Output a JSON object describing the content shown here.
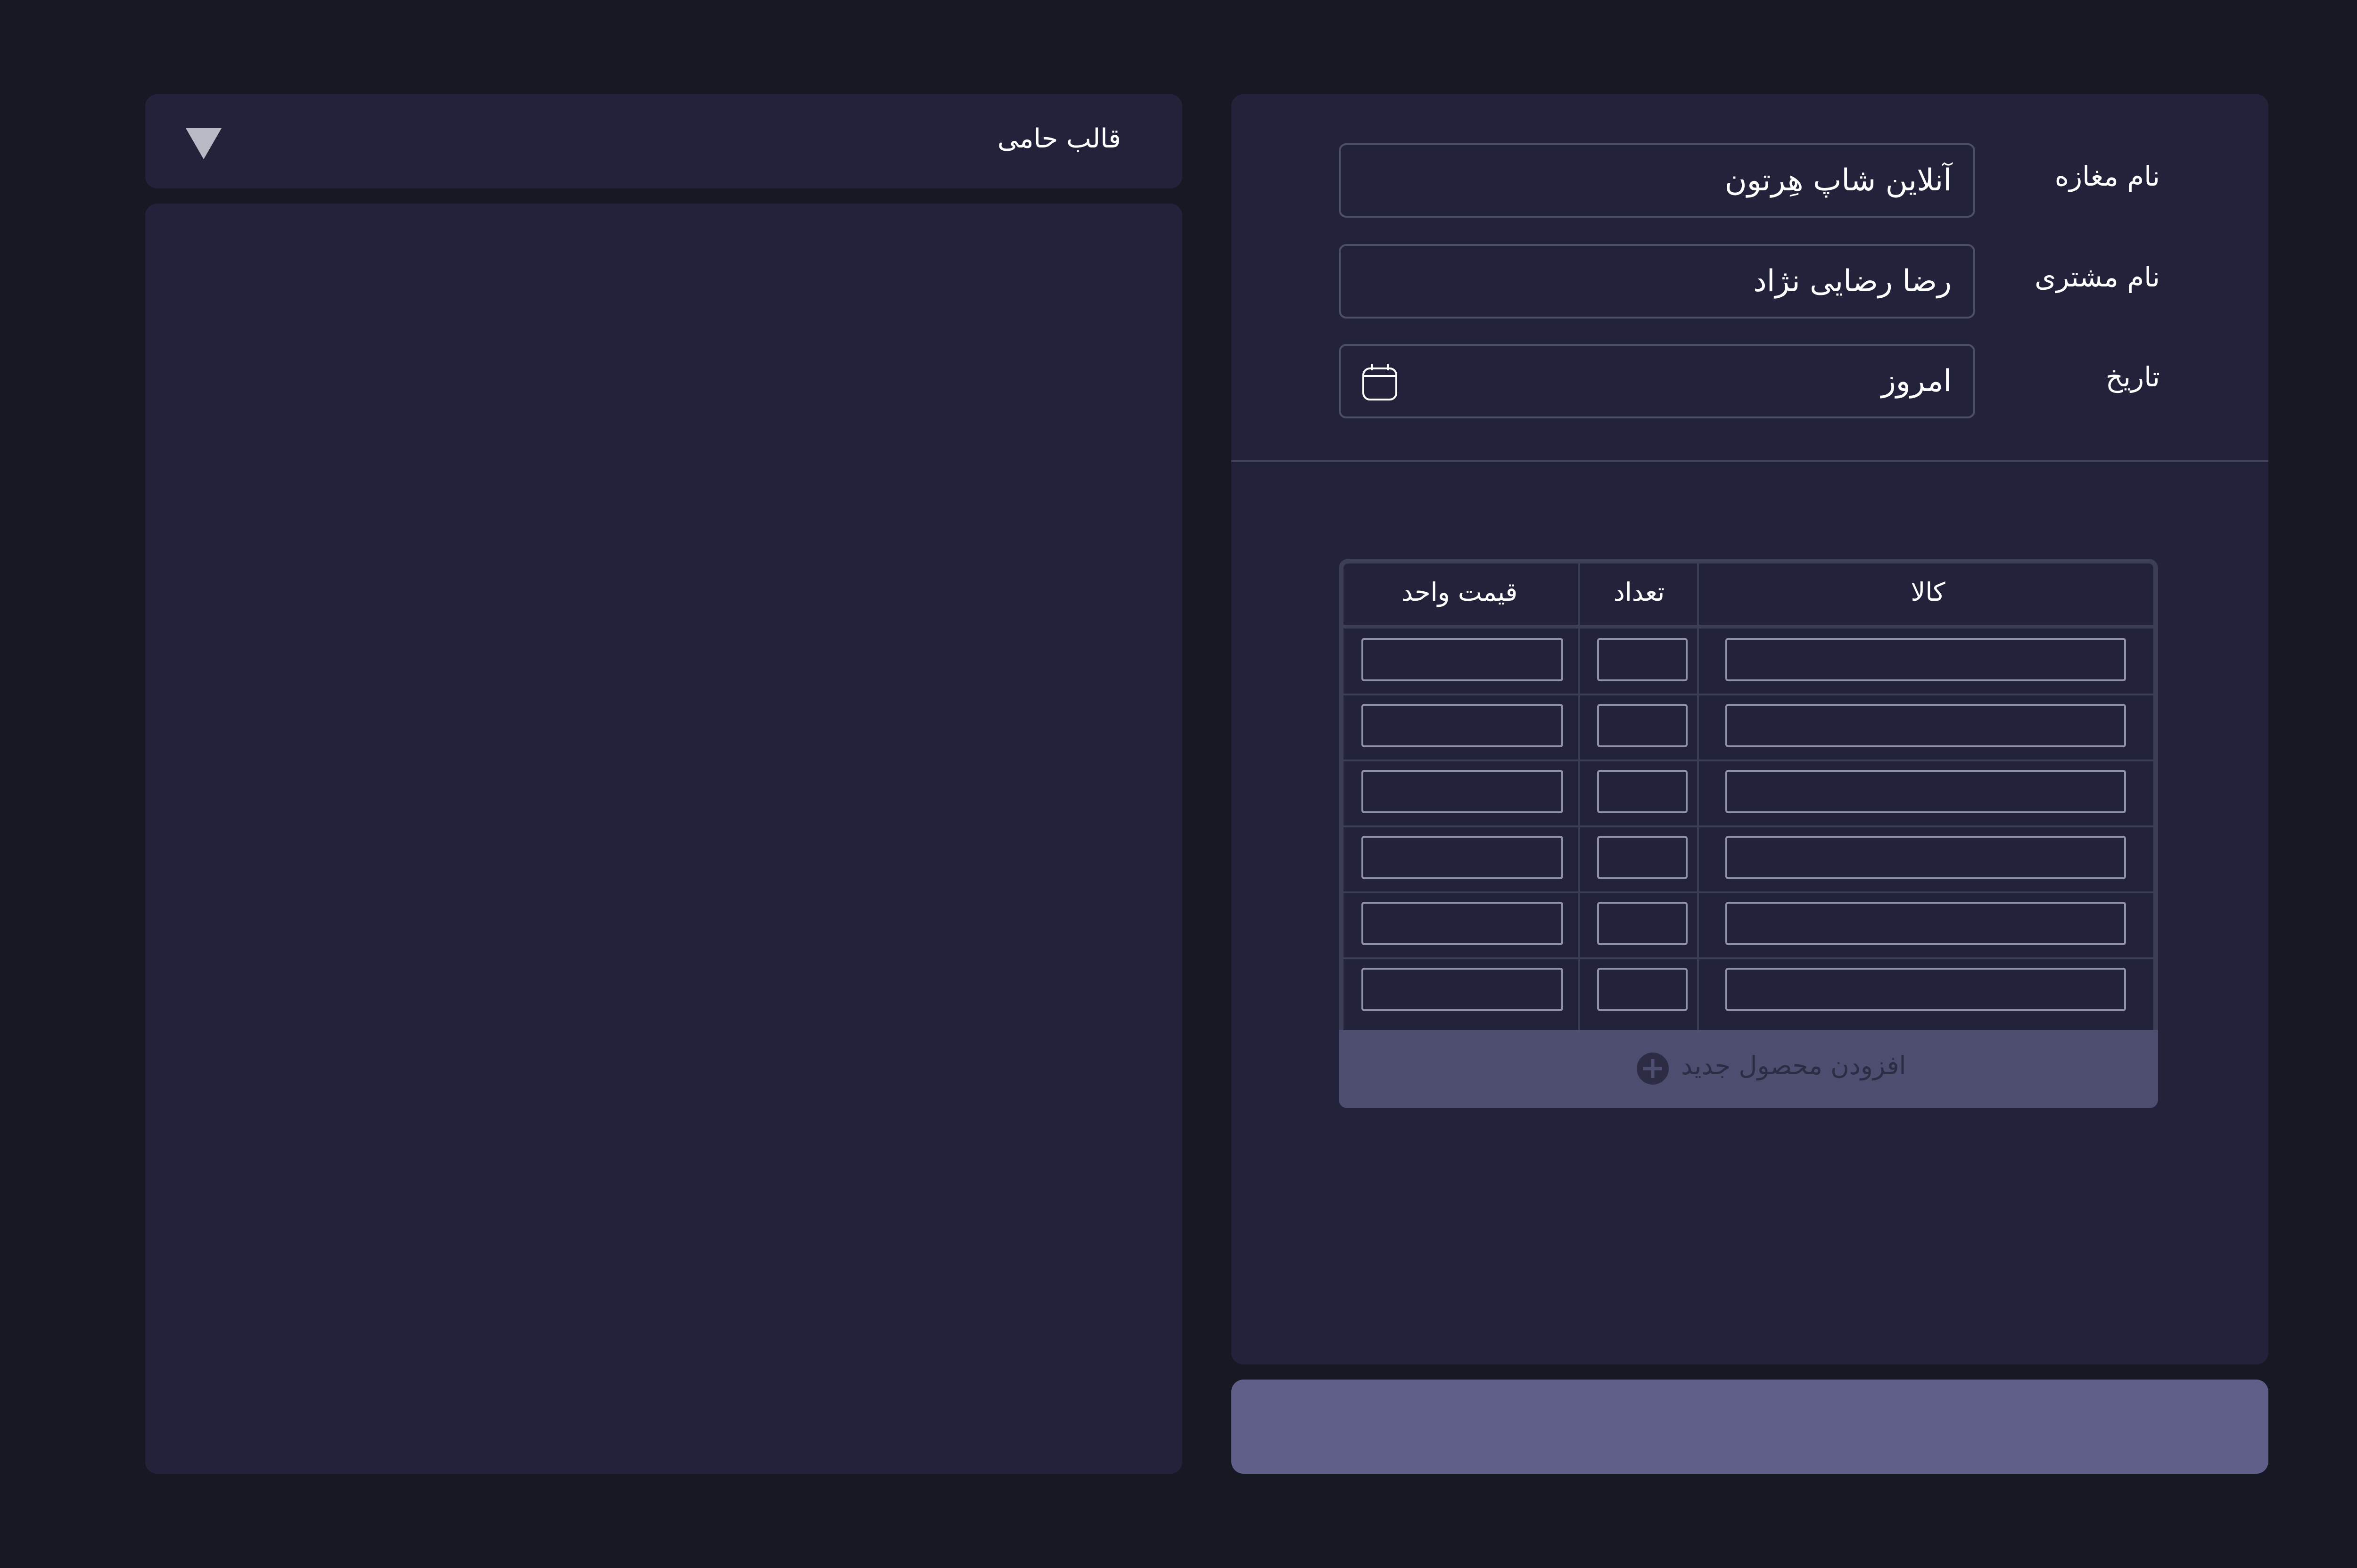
{
  "template_selector": {
    "label": "قالب حامی",
    "dropdown_icon": "triangle-down-icon"
  },
  "form": {
    "shop_name_label": "نام مغازه",
    "shop_name_value": "آنلاین شاپ هِرتون",
    "customer_name_label": "نام مشتری",
    "customer_name_value": "رضا رضایی نژاد",
    "date_label": "تاریخ",
    "date_value": "امروز",
    "date_icon": "calendar-icon"
  },
  "items_table": {
    "headers": {
      "item": "کالا",
      "quantity": "تعداد",
      "unit_price": "قیمت واحد"
    },
    "row_count": 6,
    "add_product_label": "افزودن محصول جدید",
    "add_icon": "plus-circle-icon"
  },
  "colors": {
    "background": "#161824",
    "panel": "#22233a",
    "table_border": "#3c3e57",
    "add_row": "#4d4e6f",
    "submit_button": "#5f5f8a"
  }
}
